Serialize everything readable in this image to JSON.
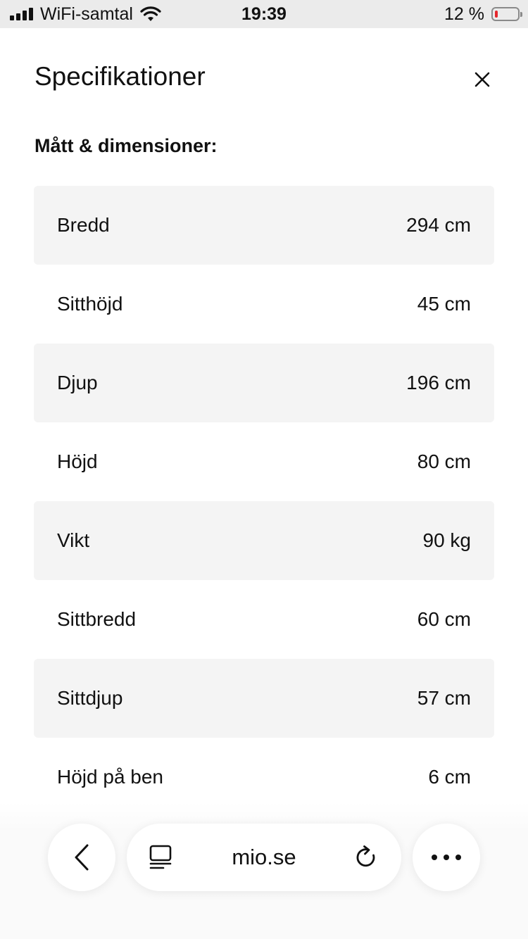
{
  "status_bar": {
    "carrier": "WiFi-samtal",
    "time": "19:39",
    "battery_percent": "12 %",
    "battery_level": 0.12,
    "battery_color": "#e4262c",
    "icons": [
      "signal-icon",
      "wifi-icon",
      "battery-icon"
    ]
  },
  "header": {
    "title": "Specifikationer",
    "close_icon": "close-icon"
  },
  "section": {
    "heading": "Mått & dimensioner:"
  },
  "specs": [
    {
      "label": "Bredd",
      "value": "294 cm"
    },
    {
      "label": "Sitthöjd",
      "value": "45 cm"
    },
    {
      "label": "Djup",
      "value": "196 cm"
    },
    {
      "label": "Höjd",
      "value": "80 cm"
    },
    {
      "label": "Vikt",
      "value": "90 kg"
    },
    {
      "label": "Sittbredd",
      "value": "60 cm"
    },
    {
      "label": "Sittdjup",
      "value": "57 cm"
    },
    {
      "label": "Höjd på ben",
      "value": "6 cm"
    }
  ],
  "browser_toolbar": {
    "url": "mio.se",
    "icons": [
      "back-icon",
      "reader-icon",
      "reload-icon",
      "more-icon"
    ]
  },
  "colors": {
    "row_shade": "#f4f4f4",
    "status_bar_bg": "#ebebeb",
    "text": "#111111"
  }
}
